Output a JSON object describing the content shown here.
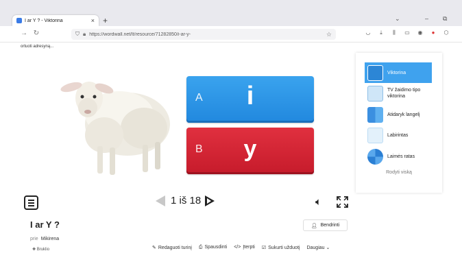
{
  "browser": {
    "tab_title": "I ar Y ? - Viktorina",
    "tab_close": "×",
    "new_tab": "+",
    "minimize": "‒",
    "restore": "⧉",
    "url": "https://wordwall.net/lt/resource/71282850/i-ar-y-",
    "bookmark": "ortuoti adresyną..."
  },
  "quiz": {
    "answers": [
      {
        "letter": "A",
        "text": "i",
        "color": "#2a95e6"
      },
      {
        "letter": "B",
        "text": "y",
        "color": "#d42535"
      }
    ],
    "pager": "1 iš 18"
  },
  "activity": {
    "title": "I ar Y ?",
    "author_prefix": "prie",
    "author_name": "Mikirena",
    "more": "✚ Bruklio",
    "share_label": "Bendrinti",
    "actions": [
      {
        "icon": "✎",
        "label": "Redaguoti turinį"
      },
      {
        "icon": "⎙",
        "label": "Spausdinti"
      },
      {
        "icon": "</>",
        "label": "Įterpti"
      },
      {
        "icon": "☑",
        "label": "Sukurti užduotį"
      },
      {
        "icon": "",
        "label": "Daugiau ⌄"
      }
    ]
  },
  "templates": {
    "items": [
      {
        "label": "Viktorina",
        "active": true
      },
      {
        "label": "TV žaidimo tipo viktorina",
        "active": false
      },
      {
        "label": "Atidaryk langelį",
        "active": false
      },
      {
        "label": "Labirintas",
        "active": false
      },
      {
        "label": "Laimės ratas",
        "active": false
      }
    ],
    "show_all": "Rodyti viską"
  }
}
